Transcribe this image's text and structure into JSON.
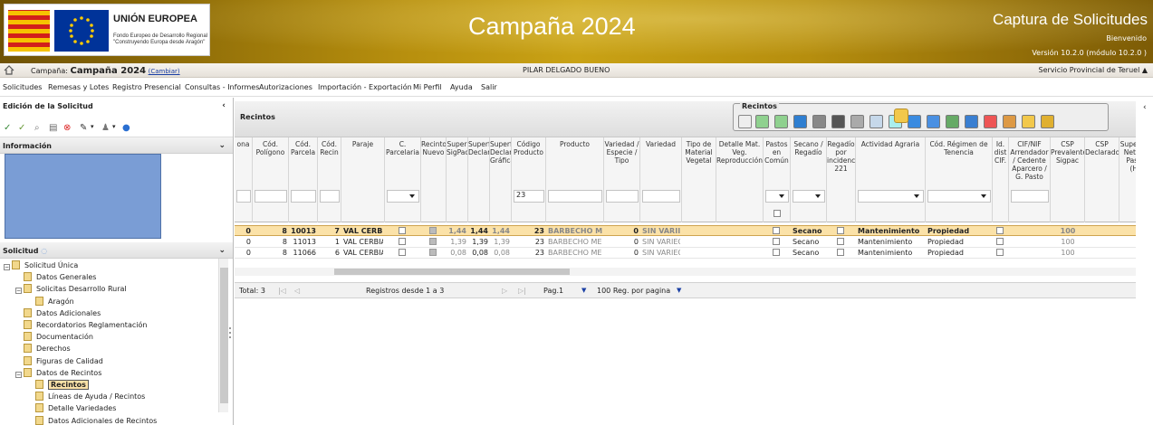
{
  "header": {
    "eu_title": "UNIÓN EUROPEA",
    "eu_subtitle_1": "Fondo Europeo de Desarrollo Regional",
    "eu_subtitle_2": "\"Construyendo Europa desde Aragón\"",
    "campaign_title": "Campaña 2024",
    "app_title": "Captura de Solicitudes",
    "welcome": "Bienvenido",
    "version": "Versión 10.2.0 (módulo 10.2.0 )"
  },
  "infobar": {
    "campaign_label": "Campaña: ",
    "campaign_value": "Campaña 2024",
    "change_link": "(Cambiar)",
    "user": "PILAR DELGADO BUENO",
    "service": "Servicio Provincial de Teruel"
  },
  "menu": [
    "Solicitudes",
    "Remesas y Lotes",
    "Registro Presencial",
    "Consultas - Informes",
    "Autorizaciones",
    "Importación - Exportación",
    "Mi Perfil",
    "Ayuda",
    "Salir"
  ],
  "left": {
    "edit_title": "Edición de la Solicitud",
    "info_title": "Información",
    "request_title": "Solicitud",
    "tree": [
      {
        "label": "Solicitud Única",
        "level": 0,
        "pm": "-"
      },
      {
        "label": "Datos Generales",
        "level": 1,
        "pm": ""
      },
      {
        "label": "Solicitas Desarrollo Rural",
        "level": 1,
        "pm": "-"
      },
      {
        "label": "Aragón",
        "level": 2,
        "pm": ""
      },
      {
        "label": "Datos Adicionales",
        "level": 1,
        "pm": ""
      },
      {
        "label": "Recordatorios Reglamentación",
        "level": 1,
        "pm": ""
      },
      {
        "label": "Documentación",
        "level": 1,
        "pm": ""
      },
      {
        "label": "Derechos",
        "level": 1,
        "pm": ""
      },
      {
        "label": "Figuras de Calidad",
        "level": 1,
        "pm": ""
      },
      {
        "label": "Datos de Recintos",
        "level": 1,
        "pm": "-"
      },
      {
        "label": "Recintos",
        "level": 2,
        "pm": "",
        "selected": true
      },
      {
        "label": "Líneas de Ayuda / Recintos",
        "level": 2,
        "pm": ""
      },
      {
        "label": "Detalle Variedades",
        "level": 2,
        "pm": ""
      },
      {
        "label": "Datos Adicionales de Recintos",
        "level": 2,
        "pm": ""
      }
    ]
  },
  "recintos": {
    "title": "Recintos",
    "toolbox_label": "Recintos"
  },
  "grid": {
    "headers": [
      "ona",
      "Cód. Polígono",
      "Cód. Parcela",
      "Cód. Recin",
      "Paraje",
      "C. Parcelaria",
      "Recinto Nuevo",
      "Super SigPac",
      "Superf Declar",
      "Superf Declar Gráfica",
      "Código Producto",
      "Producto",
      "Variedad / Especie / Tipo",
      "Variedad",
      "Tipo de Material Vegetal",
      "Detalle Mat. Veg. Reproducción",
      "Pastos en Común",
      "Secano / Regadío",
      "Regadío por incidencia 221",
      "Actividad Agraria",
      "Cód. Régimen de Tenencia",
      "Id. dist CIF.",
      "CIF/NIF Arrendador / Cedente Aparcero / G. Pasto",
      "CSP Prevalente Sigpac",
      "CSP Declarado",
      "Superficie Neta de Pastos (Ha)"
    ],
    "filter_product": "23",
    "rows": [
      {
        "zona": "0",
        "poligono": "8",
        "parcela": "10013",
        "recinto": "7",
        "paraje": "VAL CERBIA",
        "sigpac": "1,44",
        "declar": "1,44",
        "grafica": "1,44",
        "cod": "23",
        "producto": "BARBECHO ME",
        "var_code": "0",
        "variedad": "SIN VARII",
        "secano": "Secano",
        "actividad": "Mantenimiento",
        "tenencia": "Propiedad",
        "csp": "100"
      },
      {
        "zona": "0",
        "poligono": "8",
        "parcela": "11013",
        "recinto": "1",
        "paraje": "VAL CERBIAN",
        "sigpac": "1,39",
        "declar": "1,39",
        "grafica": "1,39",
        "cod": "23",
        "producto": "BARBECHO MED",
        "var_code": "0",
        "variedad": "SIN VARIEC",
        "secano": "Secano",
        "actividad": "Mantenimiento",
        "tenencia": "Propiedad",
        "csp": "100"
      },
      {
        "zona": "0",
        "poligono": "8",
        "parcela": "11066",
        "recinto": "6",
        "paraje": "VAL CERBIAN",
        "sigpac": "0,08",
        "declar": "0,08",
        "grafica": "0,08",
        "cod": "23",
        "producto": "BARBECHO MED",
        "var_code": "0",
        "variedad": "SIN VARIEC",
        "secano": "Secano",
        "actividad": "Mantenimiento",
        "tenencia": "Propiedad",
        "csp": "100"
      }
    ]
  },
  "pager": {
    "total": "Total: 3",
    "range": "Registros desde 1 a 3",
    "page": "Pag.1",
    "per_page": "100 Reg. por pagina"
  }
}
